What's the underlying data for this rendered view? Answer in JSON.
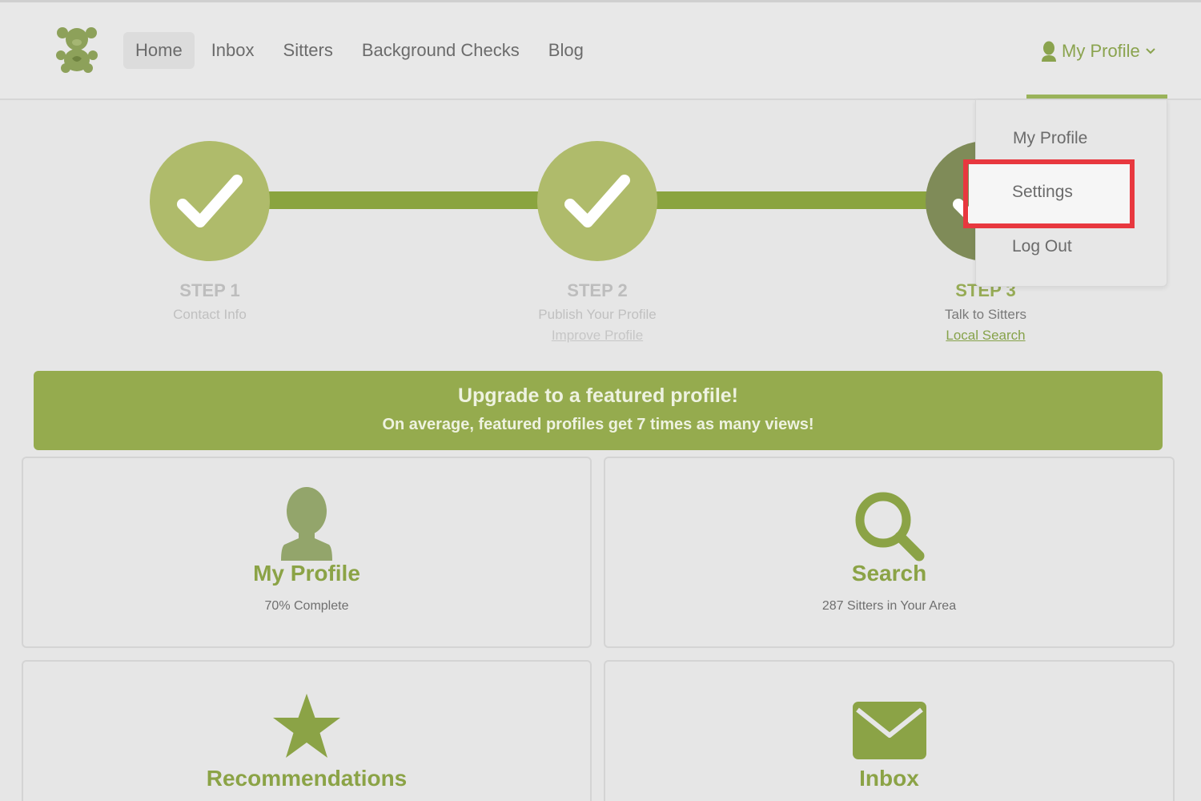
{
  "nav": {
    "items": [
      {
        "label": "Home"
      },
      {
        "label": "Inbox"
      },
      {
        "label": "Sitters"
      },
      {
        "label": "Background Checks"
      },
      {
        "label": "Blog"
      }
    ],
    "profile_label": "My Profile",
    "logo_icon": "teddy-bear-icon"
  },
  "steps": [
    {
      "title": "STEP 1",
      "subtitle": "Contact Info",
      "link": ""
    },
    {
      "title": "STEP 2",
      "subtitle": "Publish Your Profile",
      "link": "Improve Profile"
    },
    {
      "title": "STEP 3",
      "subtitle": "Talk to Sitters",
      "link": "Local Search"
    }
  ],
  "banner": {
    "title": "Upgrade to a featured profile!",
    "subtitle": "On average, featured profiles get 7 times as many views!"
  },
  "cards": {
    "profile": {
      "title": "My Profile",
      "subtitle": "70% Complete",
      "icon": "person-icon"
    },
    "search": {
      "title": "Search",
      "subtitle": "287 Sitters in Your Area",
      "icon": "search-icon"
    },
    "recommendations": {
      "title": "Recommendations",
      "icon": "star-icon"
    },
    "inbox": {
      "title": "Inbox",
      "icon": "envelope-icon"
    }
  },
  "dropdown": {
    "items": [
      {
        "label": "My Profile"
      },
      {
        "label": "Settings"
      },
      {
        "label": "Log Out"
      }
    ]
  },
  "colors": {
    "brand_green": "#95ab4e",
    "highlight_red": "#e8383f"
  }
}
